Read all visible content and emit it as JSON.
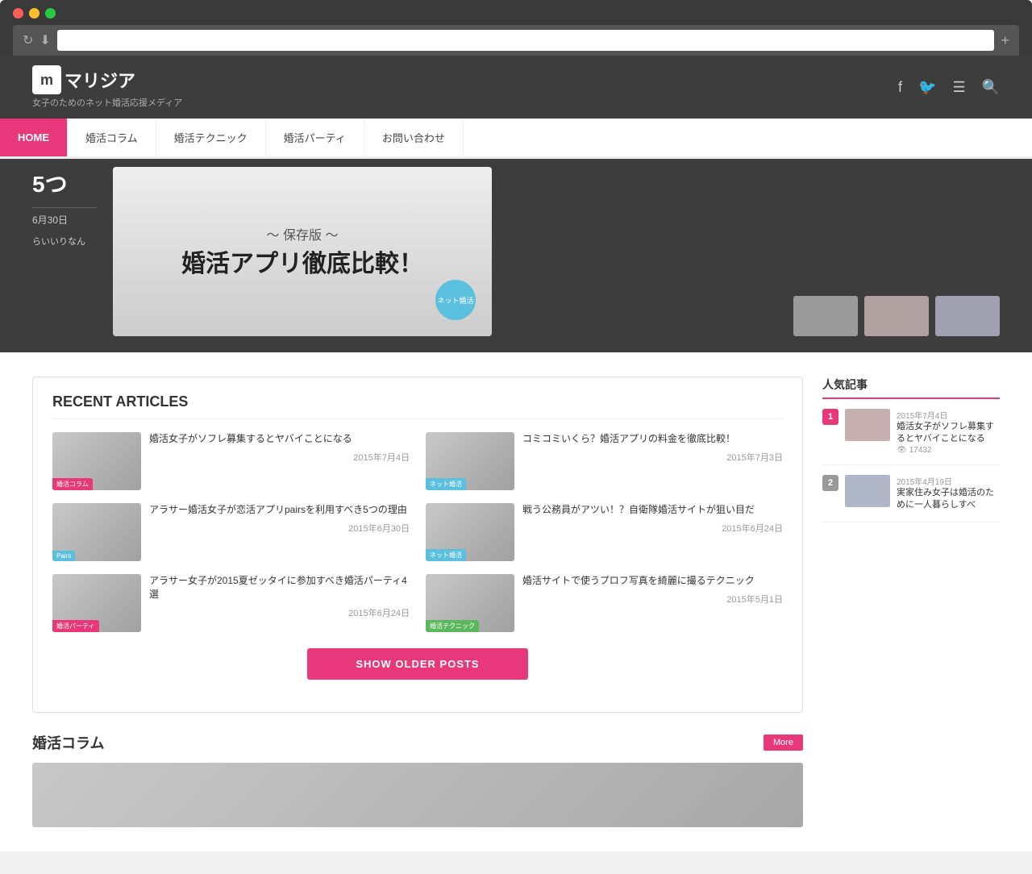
{
  "browser": {
    "url": "",
    "reload_icon": "↻",
    "download_icon": "⬇",
    "new_tab_icon": "+"
  },
  "header": {
    "logo_letter": "m",
    "logo_name": "マリジア",
    "subtitle": "女子のためのネット婚活応援メディア",
    "icons": [
      "f",
      "t",
      "rss",
      "search"
    ]
  },
  "nav": {
    "items": [
      {
        "label": "HOME",
        "active": true
      },
      {
        "label": "婚活コラム",
        "active": false
      },
      {
        "label": "婚活テクニック",
        "active": false
      },
      {
        "label": "婚活パーティ",
        "active": false
      },
      {
        "label": "お問い合わせ",
        "active": false
      }
    ]
  },
  "hero": {
    "tag": "5つ",
    "date": "6月30日",
    "text": "らいいりなん",
    "banner_subtitle": "〜 保存版 〜",
    "banner_title": "婚活アプリ徹底比較！",
    "badge_text": "ネット婚活"
  },
  "recent_articles": {
    "section_title": "RECENT ARTICLES",
    "articles": [
      {
        "title": "婚活女子がソフレ募集するとヤバイことになる",
        "date": "2015年7月4日",
        "category": "婚活コラム",
        "category_color": "pink",
        "thumb_color": "#c8b0b0"
      },
      {
        "title": "コミコミいくら？婚活アプリの料金を徹底比較！",
        "date": "2015年7月3日",
        "category": "ネット婚活",
        "category_color": "blue",
        "thumb_color": "#b0b8c8"
      },
      {
        "title": "アラサー婚活女子が恋活アプリpairsを利用すべき5つの理由",
        "date": "2015年6月30日",
        "category": "Pairs",
        "category_color": "blue",
        "thumb_color": "#b8c0b0"
      },
      {
        "title": "戦う公務員がアツい！？自衛隊婚活サイトが狙い目だ",
        "date": "2015年6月24日",
        "category": "ネット婚活",
        "category_color": "blue",
        "thumb_color": "#a8a8b8"
      },
      {
        "title": "アラサー女子が2015夏ゼッタイに参加すべき婚活パーティ4選",
        "date": "2015年6月24日",
        "category": "婚活パーティ",
        "category_color": "pink",
        "thumb_color": "#c0b8a8"
      },
      {
        "title": "婚活サイトで使うプロフ写真を綺麗に撮るテクニック",
        "date": "2015年5月1日",
        "category": "婚活テクニック",
        "category_color": "green",
        "thumb_color": "#a8c0a8"
      }
    ]
  },
  "show_older": {
    "label": "SHOW OLDER POSTS"
  },
  "konkatsu_column": {
    "title": "婚活コラム",
    "more_label": "More"
  },
  "sidebar": {
    "popular_title": "人気記事",
    "popular_items": [
      {
        "rank": "1",
        "date": "2015年7月4日",
        "title": "婚活女子がソフレ募集するとヤバイことになる",
        "views": "17432",
        "thumb_color": "#c8b0b0"
      },
      {
        "rank": "2",
        "date": "2015年4月19日",
        "title": "実家住み女子は婚活のために一人暮らしすべ",
        "views": "",
        "thumb_color": "#b0b8c8"
      }
    ]
  }
}
